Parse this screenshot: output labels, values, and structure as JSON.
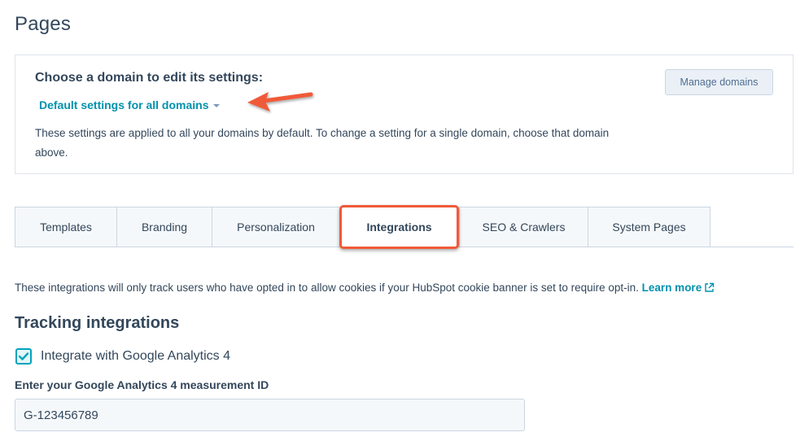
{
  "page": {
    "title": "Pages"
  },
  "domain_card": {
    "heading": "Choose a domain to edit its settings:",
    "selected_domain": "Default settings for all domains",
    "description": "These settings are applied to all your domains by default. To change a setting for a single domain, choose that domain above.",
    "manage_button": "Manage domains"
  },
  "annotations": {
    "arrow_color": "#f05a38",
    "highlight_color": "#f05a38"
  },
  "tabs": [
    {
      "label": "Templates",
      "active": false
    },
    {
      "label": "Branding",
      "active": false
    },
    {
      "label": "Personalization",
      "active": false
    },
    {
      "label": "Integrations",
      "active": true
    },
    {
      "label": "SEO & Crawlers",
      "active": false
    },
    {
      "label": "System Pages",
      "active": false
    }
  ],
  "integrations": {
    "info_text": "These integrations will only track users who have opted in to allow cookies if your HubSpot cookie banner is set to require opt-in.",
    "learn_more": "Learn more",
    "section_heading": "Tracking integrations",
    "checkbox": {
      "label": "Integrate with Google Analytics 4",
      "checked": true
    },
    "field_label": "Enter your Google Analytics 4 measurement ID",
    "field_value": "G-123456789"
  }
}
